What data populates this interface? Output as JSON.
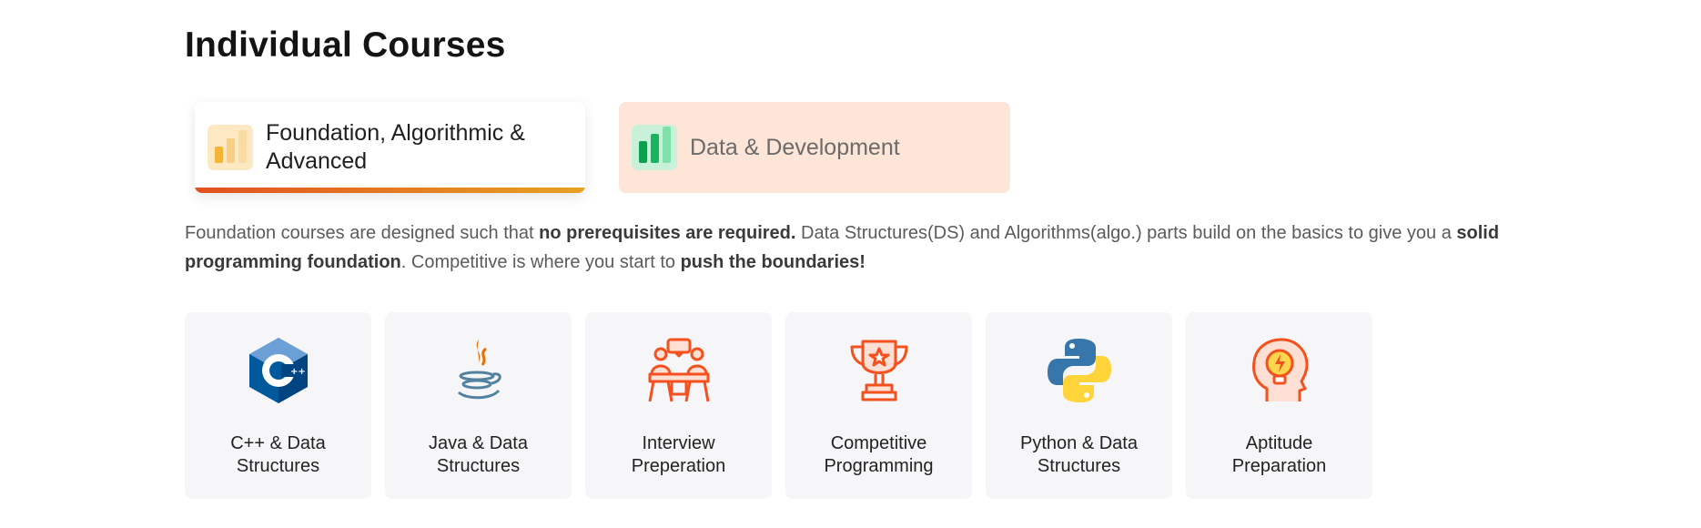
{
  "section": {
    "title": "Individual Courses"
  },
  "tabs": [
    {
      "label": "Foundation, Algorithmic & Advanced",
      "icon": "bar-chart-icon",
      "active": true,
      "accent": "#e7a124"
    },
    {
      "label": "Data & Development",
      "icon": "bar-chart-icon",
      "active": false,
      "accent": "#18b263"
    }
  ],
  "description": {
    "part1": "Foundation courses are designed such that ",
    "bold1": "no prerequisites are required.",
    "part2": " Data Structures(DS) and Algorithms(algo.) parts build on the basics to give you a ",
    "bold2": "solid programming foundation",
    "part3": ". Competitive is where you start to ",
    "bold3": "push the boundaries!"
  },
  "courses": [
    {
      "label": "C++ & Data Structures",
      "icon": "cpp-icon"
    },
    {
      "label": "Java & Data Structures",
      "icon": "java-icon"
    },
    {
      "label": "Interview Preperation",
      "icon": "interview-icon"
    },
    {
      "label": "Competitive Programming",
      "icon": "trophy-icon"
    },
    {
      "label": "Python & Data Structures",
      "icon": "python-icon"
    },
    {
      "label": "Aptitude Preparation",
      "icon": "aptitude-icon"
    }
  ]
}
